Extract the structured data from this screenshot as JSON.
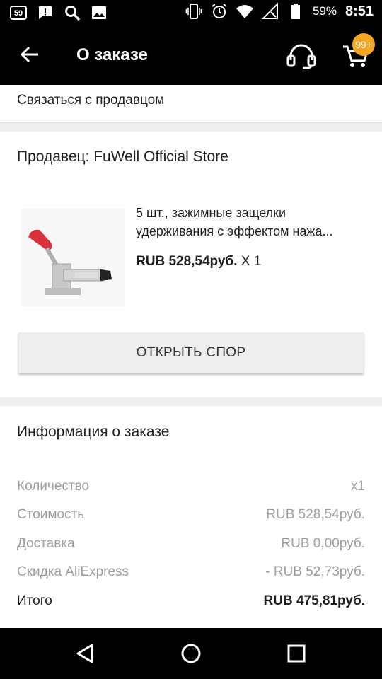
{
  "status_bar": {
    "notification_count": "59",
    "battery_percent": "59%",
    "time": "8:51",
    "icons": [
      "notification-count-icon",
      "alert-icon",
      "search-icon",
      "image-icon",
      "vibrate-icon",
      "alarm-icon",
      "wifi-icon",
      "signal-icon",
      "battery-icon"
    ]
  },
  "app_bar": {
    "title": "О заказе",
    "cart_badge": "99+",
    "icons": [
      "back-arrow-icon",
      "headset-icon",
      "cart-icon"
    ]
  },
  "contact": {
    "label": "Связаться с продавцом"
  },
  "seller": {
    "label": "Продавец: FuWell Official Store"
  },
  "product": {
    "title_line1": "5 шт., зажимные защелки",
    "title_line2": "удерживания с эффектом нажа...",
    "price": "RUB 528,54руб.",
    "qty": " X 1"
  },
  "dispute_button": {
    "label": "ОТКРЫТЬ СПОР"
  },
  "order_info": {
    "title": "Информация о заказе",
    "rows": [
      {
        "label": "Количество",
        "value": "x1"
      },
      {
        "label": "Стоимость",
        "value": "RUB 528,54руб."
      },
      {
        "label": "Доставка",
        "value": "RUB 0,00руб."
      },
      {
        "label": "Скидка AliExpress",
        "value": "- RUB 52,73руб."
      },
      {
        "label": "Итого",
        "value": "RUB 475,81руб."
      }
    ]
  },
  "colors": {
    "bar_background": "#000000",
    "badge": "#f5a623",
    "divider": "#eeeeee",
    "muted_text": "#9e9e9e"
  }
}
